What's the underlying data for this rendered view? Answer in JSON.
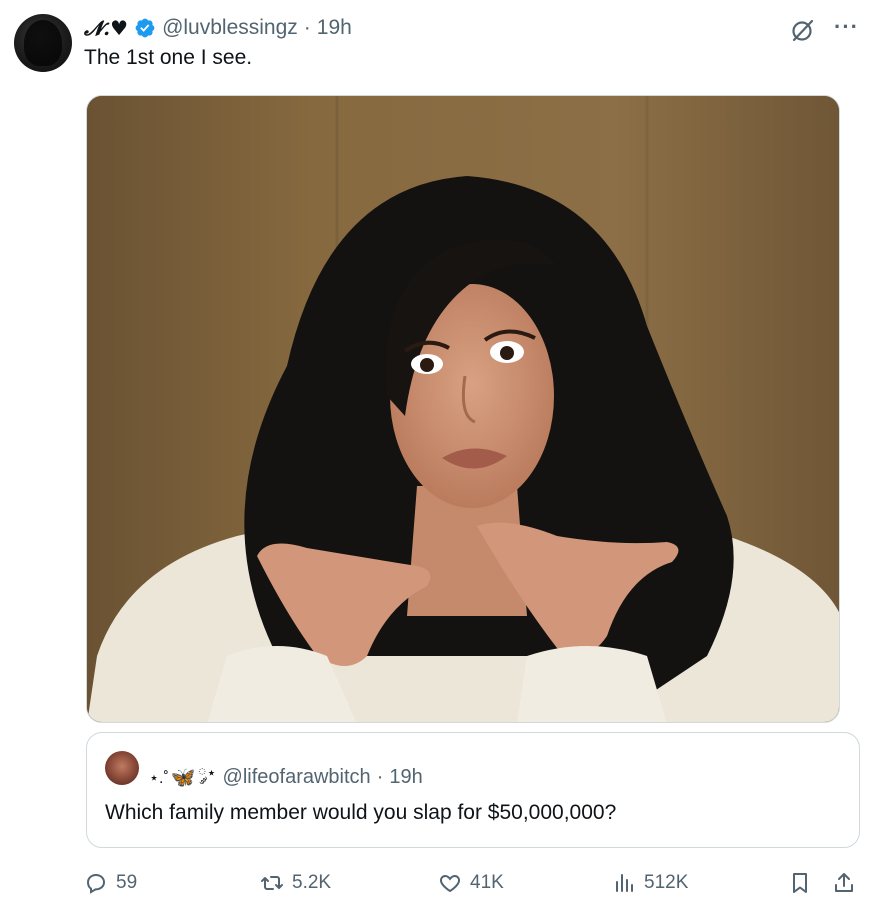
{
  "tweet": {
    "display_name": "𝓝.♥",
    "handle": "@luvblessingz",
    "separator": "·",
    "time": "19h",
    "text": "The 1st one I see.",
    "icons": {
      "verified": "verified-badge-icon",
      "grok": "grok-icon",
      "more": "more-icon"
    },
    "more_glyph": "···"
  },
  "quote": {
    "display_name_prefix": "⋆.˚",
    "display_name_emoji": "🦋",
    "display_name_suffix": "༘⋆",
    "handle": "@lifeofarawbitch",
    "separator": "·",
    "time": "19h",
    "text": "Which family member would you slap for $50,000,000?"
  },
  "actions": {
    "replies": "59",
    "reposts": "5.2K",
    "likes": "41K",
    "views": "512K"
  },
  "colors": {
    "verified": "#1d9bf0",
    "secondary_text": "#536471",
    "border": "#cfd9de"
  }
}
